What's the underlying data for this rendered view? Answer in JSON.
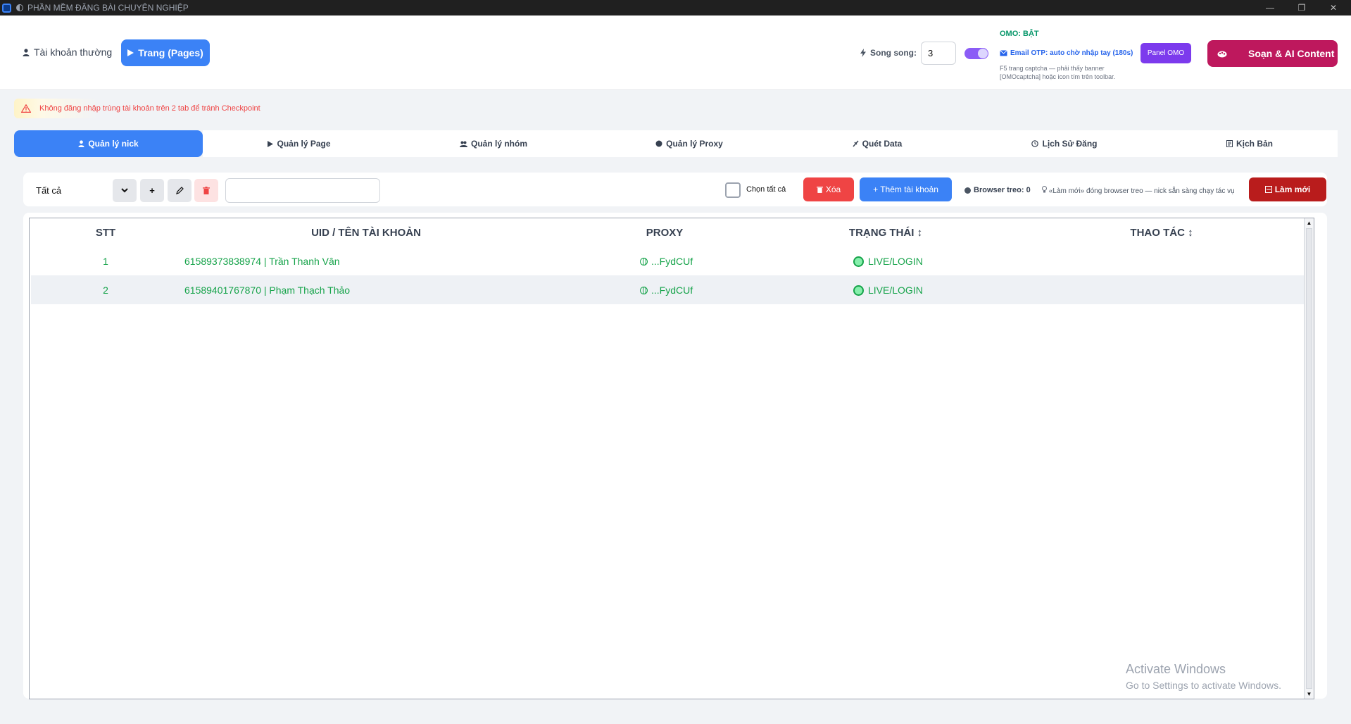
{
  "window": {
    "title": "PHẦN MỀM ĐĂNG BÀI CHUYÊN NGHIỆP",
    "controls": {
      "minimize": "—",
      "restore": "❐",
      "close": "✕"
    }
  },
  "header": {
    "account_normal": "Tài khoản thường",
    "account_pages": "Trang (Pages)",
    "parallel_label": "Song song:",
    "parallel_value": "3",
    "omo_status": "OMO: BẬT",
    "email_otp": "Email OTP: auto chờ nhập tay (180s)",
    "panel_omo": "Panel OMO",
    "captcha_note_line1": "F5 trang captcha — phải thấy banner",
    "captcha_note_line2": "[OMOcaptcha] hoặc icon tím trên toolbar.",
    "ai_button": "Soạn & AI Content"
  },
  "warning": {
    "text": "Không đăng nhập trùng tài khoản trên 2 tab để tránh Checkpoint"
  },
  "tabs": [
    {
      "label": "Quản lý nick",
      "icon": "user-icon",
      "active": true
    },
    {
      "label": "Quản lý Page",
      "icon": "play-icon",
      "active": false
    },
    {
      "label": "Quản lý nhóm",
      "icon": "group-icon",
      "active": false
    },
    {
      "label": "Quản lý Proxy",
      "icon": "globe-icon",
      "active": false
    },
    {
      "label": "Quét Data",
      "icon": "scan-icon",
      "active": false
    },
    {
      "label": "Lịch Sử Đăng",
      "icon": "clock-icon",
      "active": false
    },
    {
      "label": "Kịch Bản",
      "icon": "script-icon",
      "active": false
    }
  ],
  "toolbar": {
    "filter_value": "Tất cả",
    "add_label": "+",
    "select_all": "Chọn tất cả",
    "delete_label": "Xóa",
    "add_account": "+ Thêm tài khoản",
    "browser_label": "Browser treo: 0",
    "browser_note": "«Làm mới» đóng browser treo — nick sẵn sàng chạy tác vụ",
    "refresh_label": "Làm mới",
    "search_value": ""
  },
  "table": {
    "columns": [
      "STT",
      "UID / TÊN TÀI KHOẢN",
      "PROXY",
      "TRẠNG THÁI ↕",
      "THAO TÁC ↕"
    ],
    "rows": [
      {
        "stt": "1",
        "account": "61589373838974 | Trần Thanh Vân",
        "proxy": "...FydCUf",
        "status": "LIVE/LOGIN"
      },
      {
        "stt": "2",
        "account": "61589401767870 | Phạm Thạch Thảo",
        "proxy": "...FydCUf",
        "status": "LIVE/LOGIN"
      }
    ]
  },
  "watermark": {
    "line1": "Activate Windows",
    "line2": "Go to Settings to activate Windows."
  },
  "colors": {
    "primary": "#3b82f6",
    "danger": "#ef4444",
    "ai_button": "#be185d",
    "omo_purple": "#7c3aed",
    "live_green": "#16a34a"
  }
}
